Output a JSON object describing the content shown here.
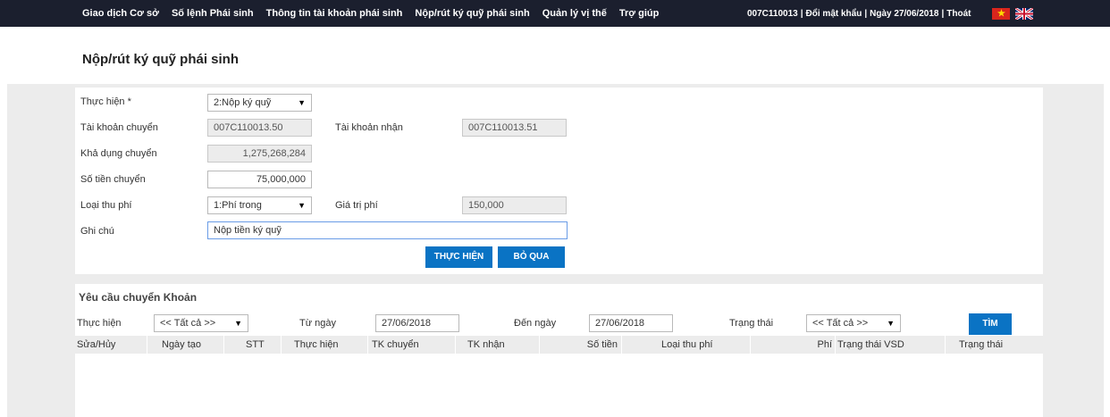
{
  "nav": {
    "items": [
      "Giao dịch Cơ sở",
      "Số lệnh Phái sinh",
      "Thông tin tài khoản phái sinh",
      "Nộp/rút ký quỹ phái sinh",
      "Quản lý vị thế",
      "Trợ giúp"
    ],
    "account": "007C110013",
    "change_password": "Đổi mật khẩu",
    "date": "Ngày 27/06/2018",
    "logout": "Thoát"
  },
  "page": {
    "title": "Nộp/rút ký quỹ phái sinh"
  },
  "form": {
    "action_label": "Thực hiện *",
    "action_value": "2:Nộp ký quỹ",
    "from_account_label": "Tài khoản chuyển",
    "from_account_value": "007C110013.50",
    "to_account_label": "Tài khoản nhận",
    "to_account_value": "007C110013.51",
    "available_label": "Khả dụng chuyển",
    "available_value": "1,275,268,284",
    "amount_label": "Số tiền chuyển",
    "amount_value": "75,000,000",
    "fee_type_label": "Loại thu phí",
    "fee_type_value": "1:Phí trong",
    "fee_value_label": "Giá trị phí",
    "fee_value": "150,000",
    "note_label": "Ghi chú",
    "note_value": "Nộp tiền ký quỹ",
    "submit_label": "THỰC HIỆN",
    "cancel_label": "BỎ QUA"
  },
  "list": {
    "title": "Yêu cầu chuyển Khoản",
    "filters": {
      "action_label": "Thực hiện",
      "action_value": "<< Tất cả >>",
      "from_date_label": "Từ ngày",
      "from_date_value": "27/06/2018",
      "to_date_label": "Đến ngày",
      "to_date_value": "27/06/2018",
      "status_label": "Trạng thái",
      "status_value": "<< Tất cả >>",
      "search_label": "TÌM"
    },
    "columns": [
      "Sửa/Hủy",
      "Ngày tạo",
      "STT",
      "Thực hiện",
      "TK chuyển",
      "TK nhận",
      "Số tiền",
      "Loại thu phí",
      "Phí",
      "Trạng thái VSD",
      "Trạng thái"
    ]
  },
  "colors": {
    "topbar": "#1b1f2e",
    "button": "#0a73c4",
    "band": "#ececec"
  }
}
